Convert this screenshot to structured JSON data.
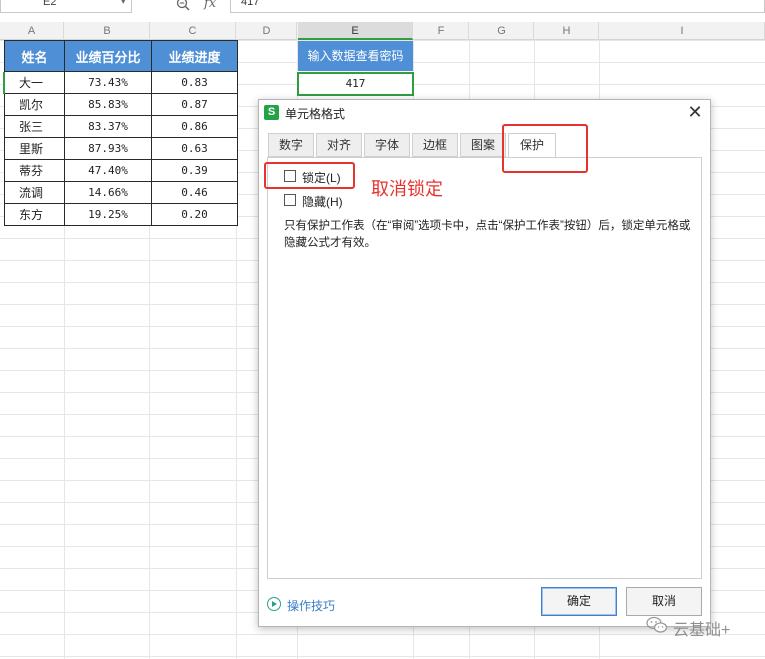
{
  "formula_bar": {
    "cell_ref": "E2",
    "fx_label": "fx",
    "value": "417"
  },
  "columns": [
    "A",
    "B",
    "C",
    "D",
    "E",
    "F",
    "G",
    "H",
    "I"
  ],
  "selected_column": "E",
  "table": {
    "headers": [
      "姓名",
      "业绩百分比",
      "业绩进度"
    ],
    "rows": [
      [
        "大一",
        "73.43%",
        "0.83"
      ],
      [
        "凯尔",
        "85.83%",
        "0.87"
      ],
      [
        "张三",
        "83.37%",
        "0.86"
      ],
      [
        "里斯",
        "87.93%",
        "0.63"
      ],
      [
        "蒂芬",
        "47.40%",
        "0.39"
      ],
      [
        "流调",
        "14.66%",
        "0.46"
      ],
      [
        "东方",
        "19.25%",
        "0.20"
      ]
    ]
  },
  "password_cell": {
    "header": "输入数据查看密码",
    "value": "417"
  },
  "dialog": {
    "app_icon": "S",
    "title": "单元格格式",
    "close_glyph": "✕",
    "tabs": [
      "数字",
      "对齐",
      "字体",
      "边框",
      "图案",
      "保护"
    ],
    "active_tab": "保护",
    "lock_label": "锁定(L)",
    "lock_checked": false,
    "hide_label": "隐藏(H)",
    "hide_checked": false,
    "help_text": "只有保护工作表（在“审阅”选项卡中，点击“保护工作表”按钮）后，锁定单元格或隐藏公式才有效。",
    "tips_label": "操作技巧",
    "ok_label": "确定",
    "cancel_label": "取消"
  },
  "annotation": {
    "text": "取消锁定",
    "color": "#e8322e"
  },
  "watermark": {
    "text": "云基础+"
  },
  "colors": {
    "header_blue": "#4f8fd6",
    "selection_green": "#2e9e3f",
    "wps_green": "#24a346"
  }
}
